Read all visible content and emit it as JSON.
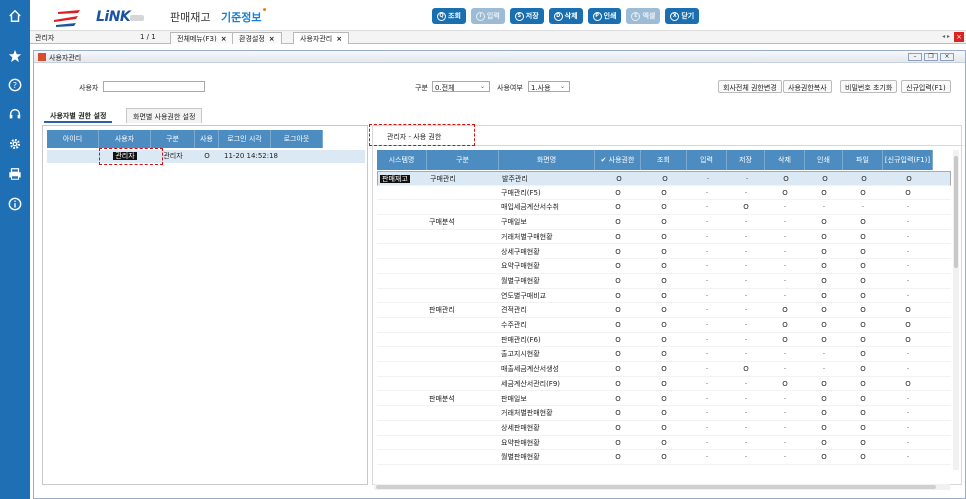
{
  "header": {
    "logo_text": "LiNK",
    "nav": [
      "판매재고",
      "기준정보"
    ],
    "buttons": [
      {
        "icon": "Q",
        "label": "조회",
        "enabled": true
      },
      {
        "icon": "I",
        "label": "입력",
        "enabled": false
      },
      {
        "icon": "S",
        "label": "저장",
        "enabled": true
      },
      {
        "icon": "D",
        "label": "삭제",
        "enabled": true
      },
      {
        "icon": "P",
        "label": "인쇄",
        "enabled": true
      },
      {
        "icon": "E",
        "label": "엑셀",
        "enabled": false
      },
      {
        "icon": "X",
        "label": "닫기",
        "enabled": true
      }
    ]
  },
  "tabbar": {
    "user": "관리자",
    "page": "1 / 1",
    "tabs": [
      {
        "label": "전체메뉴(F3)"
      },
      {
        "label": "환경설정"
      },
      {
        "label": "사용자관리",
        "active": true
      }
    ]
  },
  "window": {
    "title": "사용자관리",
    "search": {
      "user_label": "사용자",
      "user_value": "",
      "type_label": "구분",
      "type_value": "0.전체",
      "use_label": "사용여부",
      "use_value": "1.사용"
    },
    "actions": [
      "회사전체 권한변경",
      "사용권한복사",
      "비밀번호 초기화",
      "신규입력(F1)"
    ],
    "subtabs": [
      "사용자별 권한 설정",
      "화면별 사용권한 설정"
    ]
  },
  "users_table": {
    "columns": [
      "아이디",
      "사용자",
      "구분",
      "사용",
      "로그인 시각",
      "로그아웃"
    ],
    "rows": [
      {
        "id": "",
        "user": "관리자",
        "type": "관리자",
        "use": "O",
        "login": "11-20 14:52:18",
        "logout": ""
      }
    ]
  },
  "perm_title": "관리자 - 사용 권한",
  "perm_table": {
    "columns": [
      "시스템명",
      "구분",
      "화면명",
      "사용권한",
      "조회",
      "입력",
      "저장",
      "삭제",
      "인쇄",
      "파일",
      "[신규입력(F1)]"
    ],
    "rows": [
      {
        "sys": "판매재고",
        "grp": "구매관리",
        "screen": "발주관리",
        "vals": [
          "O",
          "O",
          "·",
          "·",
          "O",
          "O",
          "O",
          "O"
        ]
      },
      {
        "sys": "",
        "grp": "",
        "screen": "구매관리(F5)",
        "vals": [
          "O",
          "O",
          "·",
          "·",
          "O",
          "O",
          "O",
          "O"
        ]
      },
      {
        "sys": "",
        "grp": "",
        "screen": "매입세금계산서수취",
        "vals": [
          "O",
          "O",
          "·",
          "O",
          "·",
          "·",
          "·",
          "·"
        ]
      },
      {
        "sys": "",
        "grp": "구매분석",
        "screen": "구매일보",
        "vals": [
          "O",
          "O",
          "·",
          "·",
          "·",
          "O",
          "O",
          "·"
        ]
      },
      {
        "sys": "",
        "grp": "",
        "screen": "거래처별구매현황",
        "vals": [
          "O",
          "O",
          "·",
          "·",
          "·",
          "O",
          "O",
          "·"
        ]
      },
      {
        "sys": "",
        "grp": "",
        "screen": "상세구매현황",
        "vals": [
          "O",
          "O",
          "·",
          "·",
          "·",
          "O",
          "O",
          "·"
        ]
      },
      {
        "sys": "",
        "grp": "",
        "screen": "요약구매현황",
        "vals": [
          "O",
          "O",
          "·",
          "·",
          "·",
          "O",
          "O",
          "·"
        ]
      },
      {
        "sys": "",
        "grp": "",
        "screen": "월별구매현황",
        "vals": [
          "O",
          "O",
          "·",
          "·",
          "·",
          "O",
          "O",
          "·"
        ]
      },
      {
        "sys": "",
        "grp": "",
        "screen": "연도별구매비교",
        "vals": [
          "O",
          "O",
          "·",
          "·",
          "·",
          "O",
          "O",
          "·"
        ]
      },
      {
        "sys": "",
        "grp": "판매관리",
        "screen": "견적관리",
        "vals": [
          "O",
          "O",
          "·",
          "·",
          "O",
          "O",
          "O",
          "O"
        ]
      },
      {
        "sys": "",
        "grp": "",
        "screen": "수주관리",
        "vals": [
          "O",
          "O",
          "·",
          "·",
          "O",
          "O",
          "O",
          "O"
        ]
      },
      {
        "sys": "",
        "grp": "",
        "screen": "판매관리(F6)",
        "vals": [
          "O",
          "O",
          "·",
          "·",
          "O",
          "O",
          "O",
          "O"
        ]
      },
      {
        "sys": "",
        "grp": "",
        "screen": "출고지시현황",
        "vals": [
          "O",
          "O",
          "·",
          "·",
          "·",
          "·",
          "O",
          "·"
        ]
      },
      {
        "sys": "",
        "grp": "",
        "screen": "매출세금계산서생성",
        "vals": [
          "O",
          "O",
          "·",
          "O",
          "·",
          "·",
          "O",
          "·"
        ]
      },
      {
        "sys": "",
        "grp": "",
        "screen": "세금계산서관리(F9)",
        "vals": [
          "O",
          "O",
          "·",
          "·",
          "O",
          "O",
          "O",
          "O"
        ]
      },
      {
        "sys": "",
        "grp": "판매분석",
        "screen": "판매일보",
        "vals": [
          "O",
          "O",
          "·",
          "·",
          "·",
          "O",
          "O",
          "·"
        ]
      },
      {
        "sys": "",
        "grp": "",
        "screen": "거래처별판매현황",
        "vals": [
          "O",
          "O",
          "·",
          "·",
          "·",
          "O",
          "O",
          "·"
        ]
      },
      {
        "sys": "",
        "grp": "",
        "screen": "상세판매현황",
        "vals": [
          "O",
          "O",
          "·",
          "·",
          "·",
          "O",
          "O",
          "·"
        ]
      },
      {
        "sys": "",
        "grp": "",
        "screen": "요약판매현황",
        "vals": [
          "O",
          "O",
          "·",
          "·",
          "·",
          "O",
          "O",
          "·"
        ]
      },
      {
        "sys": "",
        "grp": "",
        "screen": "월별판매현황",
        "vals": [
          "O",
          "O",
          "·",
          "·",
          "·",
          "O",
          "O",
          "·"
        ]
      }
    ]
  },
  "rail_icons": [
    "home-icon",
    "star-icon",
    "help-icon",
    "headset-icon",
    "gear-icon",
    "printer-icon",
    "info-icon"
  ],
  "colors": {
    "rail": "#1f6fb5",
    "button": "#1a6fb0",
    "grid_header": "#4c8cc0",
    "selected_row": "#dbe9f5",
    "highlight": "#d01010"
  }
}
